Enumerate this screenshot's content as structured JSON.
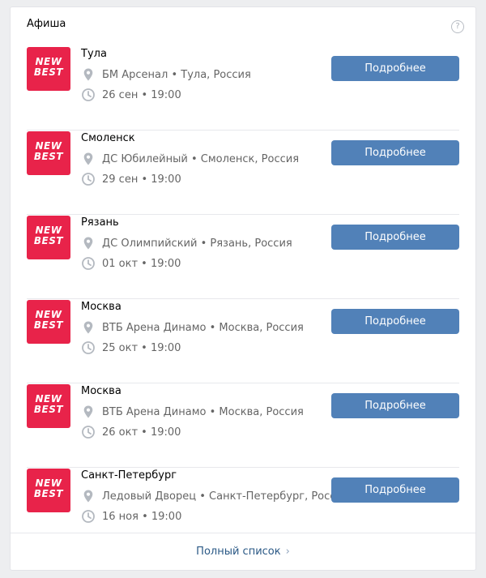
{
  "header": {
    "title": "Афиша",
    "help_icon": "question-circle-icon"
  },
  "button_label": "Подробнее",
  "logo": {
    "line1": "NEW",
    "line2": "BEST",
    "color": "#e8234a"
  },
  "events": [
    {
      "city": "Тула",
      "venue": "БМ Арсенал • Тула, Россия",
      "datetime": "26 сен • 19:00"
    },
    {
      "city": "Смоленск",
      "venue": "ДС Юбилейный • Смоленск, Россия",
      "datetime": "29 сен • 19:00"
    },
    {
      "city": "Рязань",
      "venue": "ДС Олимпийский • Рязань, Россия",
      "datetime": "01 окт • 19:00"
    },
    {
      "city": "Москва",
      "venue": "ВТБ Арена Динамо • Москва, Россия",
      "datetime": "25 окт • 19:00"
    },
    {
      "city": "Москва",
      "venue": "ВТБ Арена Динамо • Москва, Россия",
      "datetime": "26 окт • 19:00"
    },
    {
      "city": "Санкт-Петербург",
      "venue": "Ледовый Дворец • Санкт-Петербург, Россия",
      "datetime": "16 ноя • 19:00"
    }
  ],
  "footer": {
    "link_label": "Полный список",
    "chevron": "›"
  },
  "colors": {
    "accent": "#5181b8",
    "link": "#2a5885"
  }
}
